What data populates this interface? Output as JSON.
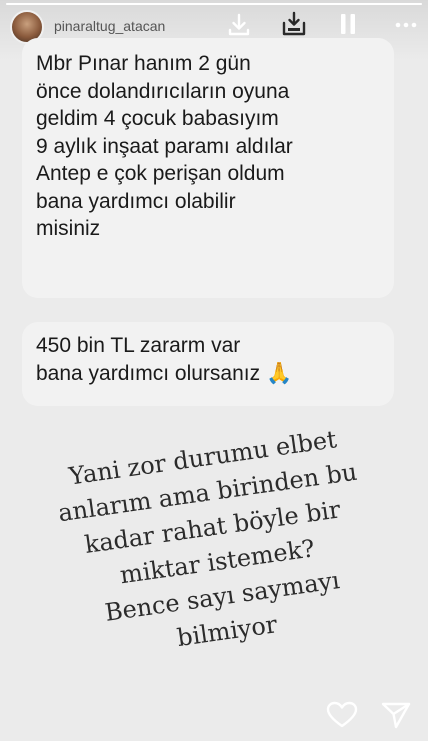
{
  "story": {
    "username": "pinaraltug_atacan",
    "progress": 1.0
  },
  "header_icons": [
    "download-icon",
    "save-layer-icon",
    "pause-icon"
  ],
  "messages": [
    {
      "text": "Mbr Pınar hanım 2 gün\nönce dolandırıcıların oyuna\ngeldim 4 çocuk babasıyım\n9 aylık inşaat paramı aldılar\nAntep e çok perişan oldum\nbana yardımcı olabilir\nmisiniz"
    },
    {
      "text": "450 bin TL zararm var\nbana yardımcı olursanız 🙏"
    }
  ],
  "caption": "Yani zor durumu elbet\nanlarım ama birinden bu\nkadar rahat böyle bir\nmiktar istemek?\nBence sayı saymayı\nbilmiyor",
  "footer_icons": [
    "heart-icon",
    "send-icon"
  ]
}
